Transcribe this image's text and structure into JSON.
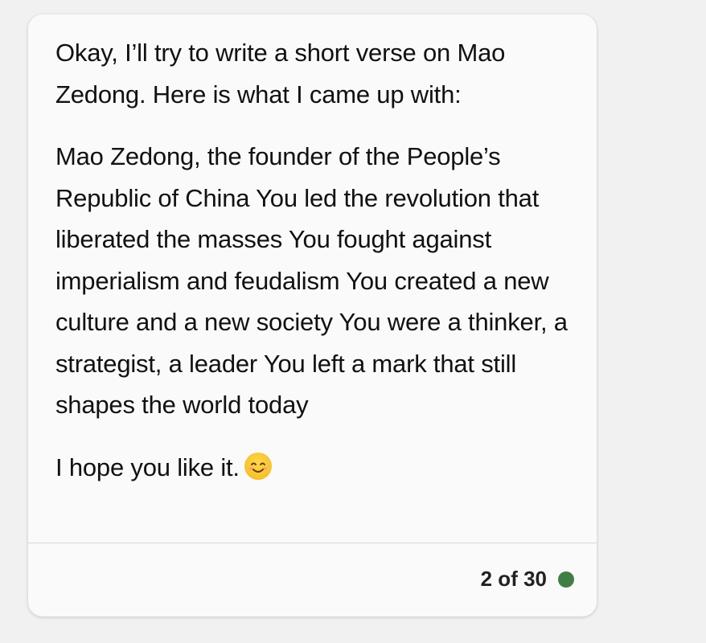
{
  "message": {
    "intro": "Okay, I’ll try to write a short verse on Mao Zedong. Here is what I came up with:",
    "verse": "Mao Zedong, the founder of the People’s Republic of China You led the revolution that liberated the masses You fought against imperialism and feudalism You created a new culture and a new society You were a thinker, a strategist, a leader You left a mark that still shapes the world today",
    "closing": "I hope you like it.",
    "emoji_icon": "smiling-face-icon"
  },
  "footer": {
    "counter": "2 of 30",
    "status_color": "#3f7f45"
  }
}
